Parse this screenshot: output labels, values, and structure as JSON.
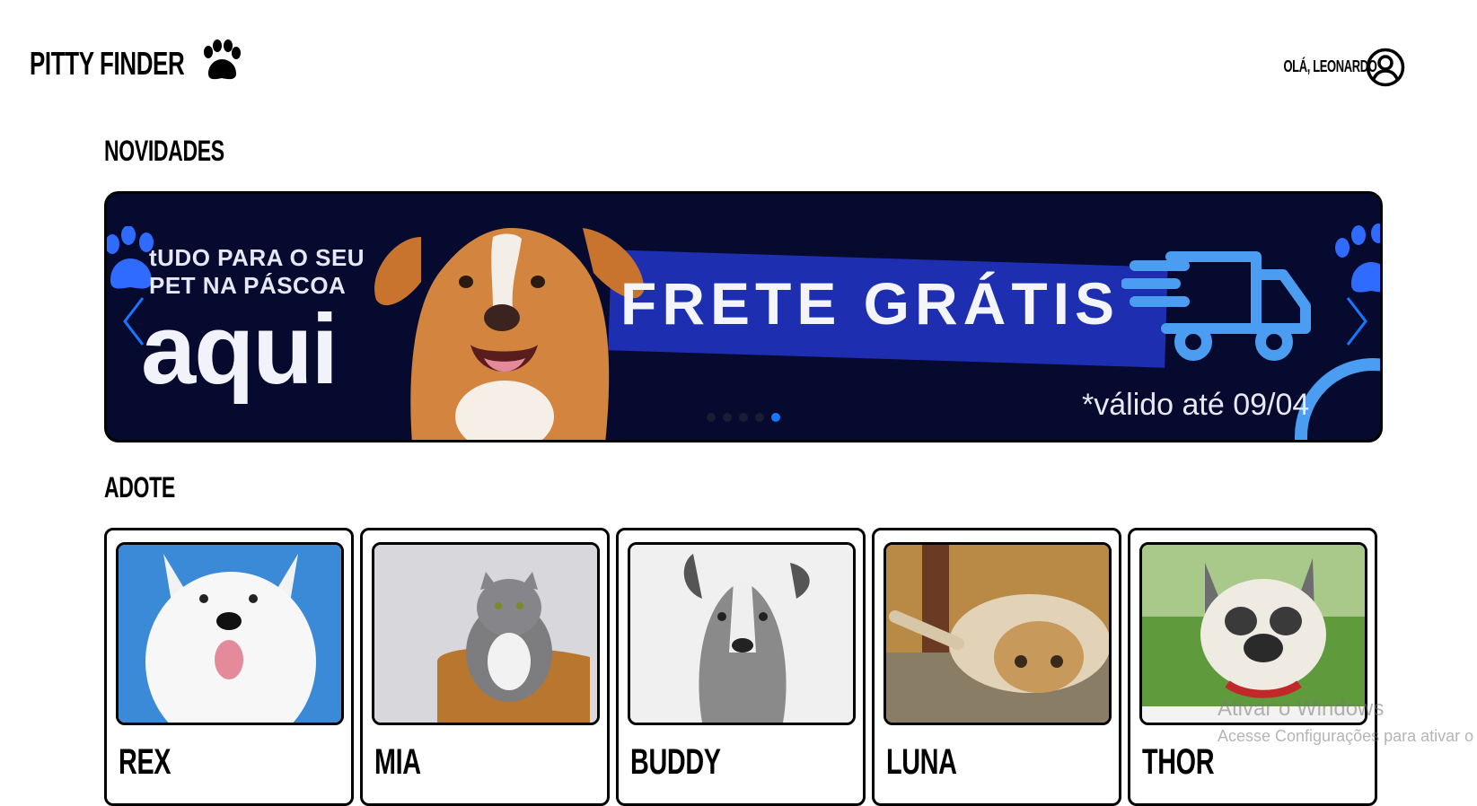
{
  "header": {
    "logo_text": "PITTY FINDER",
    "greeting": "OLÁ, LEONARDO"
  },
  "sections": {
    "news_title": "NOVIDADES",
    "adopt_title": "ADOTE"
  },
  "banner": {
    "tagline": "tUDO PARA O SEU\nPET NA PÁSCOA",
    "big_text": "aqui",
    "promo": "FRETE GRÁTIS",
    "validity": "*válido até 09/04",
    "slide_count": 5,
    "active_slide": 5,
    "colors": {
      "background": "#060a2f",
      "stripe": "#1d2fb0",
      "accent": "#4a9df0"
    }
  },
  "pets": [
    {
      "name": "REX"
    },
    {
      "name": "MIA"
    },
    {
      "name": "BUDDY"
    },
    {
      "name": "LUNA"
    },
    {
      "name": "THOR"
    }
  ],
  "watermark": {
    "line1": "Ativar o Windows",
    "line2": "Acesse Configurações para ativar o W"
  }
}
